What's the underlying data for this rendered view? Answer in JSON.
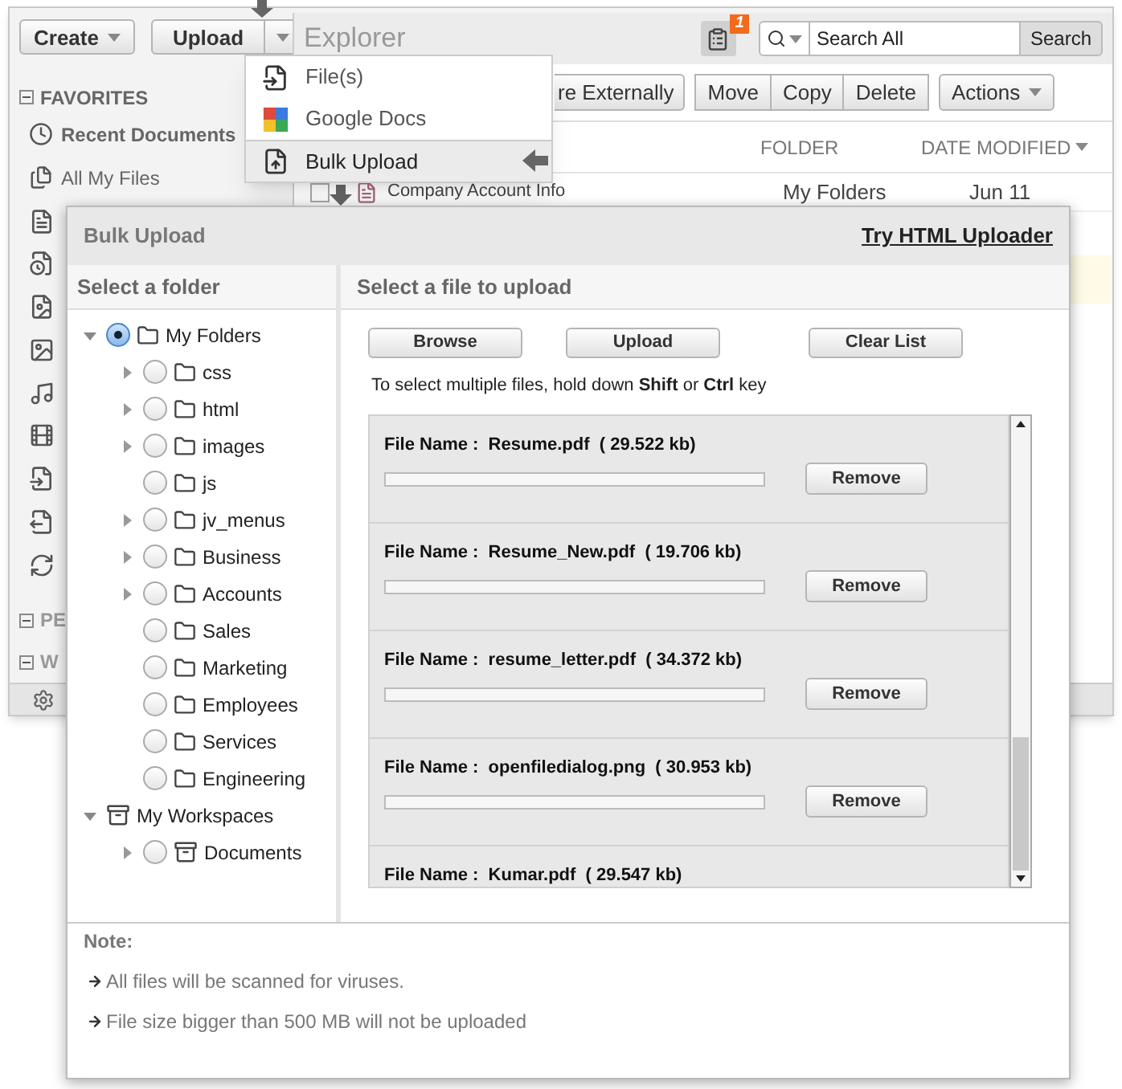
{
  "toolbar": {
    "create": "Create",
    "upload": "Upload"
  },
  "upload_menu": [
    {
      "label": "File(s)",
      "kind": "file",
      "selected": false
    },
    {
      "label": "Google Docs",
      "kind": "google",
      "selected": false
    },
    {
      "label": "Bulk Upload",
      "kind": "bulk",
      "selected": true
    }
  ],
  "explorer": {
    "title": "Explorer",
    "task_badge": "1",
    "search": {
      "value": "Search All"
    },
    "search_button": "Search",
    "actions": [
      "re Externally",
      "Move",
      "Copy",
      "Delete"
    ],
    "actions_menu": "Actions",
    "columns": [
      "FOLDER",
      "DATE MODIFIED"
    ],
    "rows": [
      {
        "checked": false,
        "name": "Company Account Info",
        "folder": "My Folders",
        "date": "Jun 11"
      }
    ]
  },
  "sidebar": {
    "section": "FAVORITES",
    "items": [
      {
        "label": "Recent Documents",
        "bold": true
      },
      {
        "label": "All My Files",
        "bold": false
      }
    ],
    "collapsed_sections": [
      "PE",
      "W"
    ]
  },
  "dialog": {
    "title": "Bulk Upload",
    "link": "Try HTML Uploader",
    "folder_header": "Select a folder",
    "file_header": "Select a file to upload",
    "buttons": [
      "Browse",
      "Upload",
      "Clear List"
    ],
    "hint": "To select multiple files, hold down **Shift** or **Ctrl** key",
    "tree": [
      {
        "label": "My Folders",
        "kind": "folder",
        "has_children": true,
        "expanded": true,
        "selected": true,
        "children": [
          {
            "label": "css",
            "kind": "folder",
            "has_children": true,
            "expanded": false,
            "selected": false
          },
          {
            "label": "html",
            "kind": "folder",
            "has_children": true,
            "expanded": false,
            "selected": false
          },
          {
            "label": "images",
            "kind": "folder",
            "has_children": true,
            "expanded": false,
            "selected": false
          },
          {
            "label": "js",
            "kind": "folder",
            "has_children": false,
            "expanded": false,
            "selected": false
          },
          {
            "label": "jv_menus",
            "kind": "folder",
            "has_children": true,
            "expanded": false,
            "selected": false
          },
          {
            "label": "Business",
            "kind": "folder",
            "has_children": true,
            "expanded": false,
            "selected": false
          },
          {
            "label": "Accounts",
            "kind": "folder",
            "has_children": true,
            "expanded": false,
            "selected": false
          },
          {
            "label": "Sales",
            "kind": "folder",
            "has_children": false,
            "expanded": false,
            "selected": false
          },
          {
            "label": "Marketing",
            "kind": "folder",
            "has_children": false,
            "expanded": false,
            "selected": false
          },
          {
            "label": "Employees",
            "kind": "folder",
            "has_children": false,
            "expanded": false,
            "selected": false
          },
          {
            "label": "Services",
            "kind": "folder",
            "has_children": false,
            "expanded": false,
            "selected": false
          },
          {
            "label": "Engineering",
            "kind": "folder",
            "has_children": false,
            "expanded": false,
            "selected": false
          }
        ]
      },
      {
        "label": "My Workspaces",
        "kind": "workspace",
        "has_children": true,
        "expanded": true,
        "children": [
          {
            "label": "Documents",
            "kind": "cabinet",
            "has_children": true,
            "expanded": false,
            "selected": false
          }
        ]
      }
    ],
    "files": [
      {
        "label": "File Name :  Resume.pdf  ( 29.522 kb)",
        "level": 0,
        "button": "Remove"
      },
      {
        "label": "File Name :  Resume_New.pdf  ( 19.706 kb)",
        "level": 0,
        "button": "Remove"
      },
      {
        "label": "File Name :  resume_letter.pdf  ( 34.372 kb)",
        "level": 0,
        "button": "Remove"
      },
      {
        "label": "File Name :  openfiledialog.png  ( 30.953 kb)",
        "level": 0,
        "button": "Remove"
      },
      {
        "label": "File Name :  Kumar.pdf  ( 29.547 kb)"
      }
    ],
    "note_title": "Note:",
    "notes": [
      "All files will be scanned for viruses.",
      "File size bigger than 500 MB will not be uploaded"
    ]
  }
}
